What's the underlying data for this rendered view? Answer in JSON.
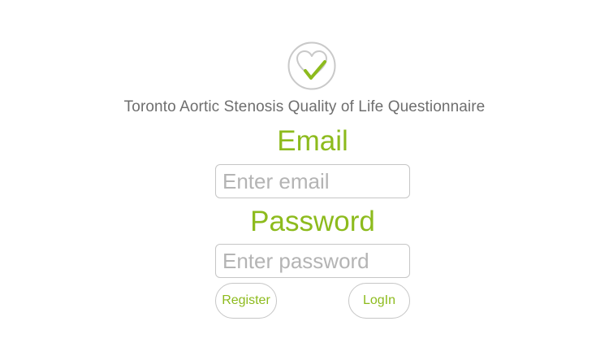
{
  "app": {
    "logo_icon": "heart-check-icon",
    "title": "Toronto Aortic Stenosis Quality of Life Questionnaire"
  },
  "form": {
    "email_label": "Email",
    "email_placeholder": "Enter email",
    "email_value": "",
    "password_label": "Password",
    "password_placeholder": "Enter password",
    "password_value": ""
  },
  "actions": {
    "register_label": "Register",
    "login_label": "LogIn"
  },
  "colors": {
    "accent": "#8dbb1d",
    "border": "#c6c6c6",
    "title_text": "#6e6e6e",
    "placeholder": "#b4b4b4"
  }
}
